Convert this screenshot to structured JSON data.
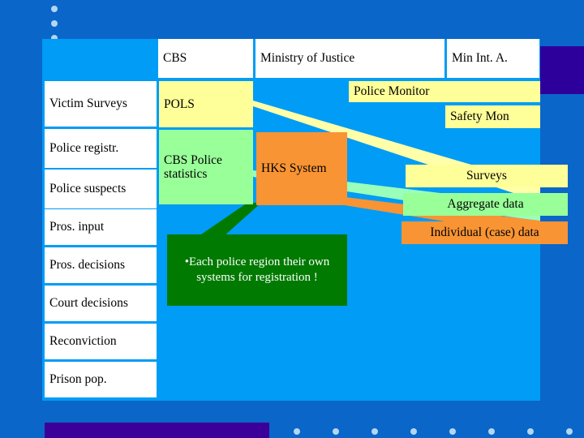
{
  "slide": {
    "background_color": "#0a66c8",
    "panel_color": "#009cf5",
    "accent_purple": "#3a0099"
  },
  "table": {
    "column_headers": [
      "",
      "CBS",
      "Ministry of Justice",
      "Min Int. A."
    ],
    "row_labels": [
      "Victim Surveys",
      "Police registr.",
      "Police suspects",
      "Pros. input",
      "Pros. decisions",
      "Court decisions",
      "Reconviction",
      "Prison pop."
    ]
  },
  "systems": {
    "pols": "POLS",
    "cbs_police_statistics": "CBS Police\nstatistics",
    "hks_system": "HKS System",
    "police_monitor": "Police Monitor",
    "safety_mon": "Safety Mon"
  },
  "legend": {
    "items": [
      {
        "label": "Surveys",
        "color": "#ffff99"
      },
      {
        "label": "Aggregate data",
        "color": "#99ff99"
      },
      {
        "label": "Individual (case) data",
        "color": "#f89434"
      }
    ]
  },
  "callout": {
    "text": "•Each police region their own systems for registration !",
    "color": "#007a00"
  }
}
